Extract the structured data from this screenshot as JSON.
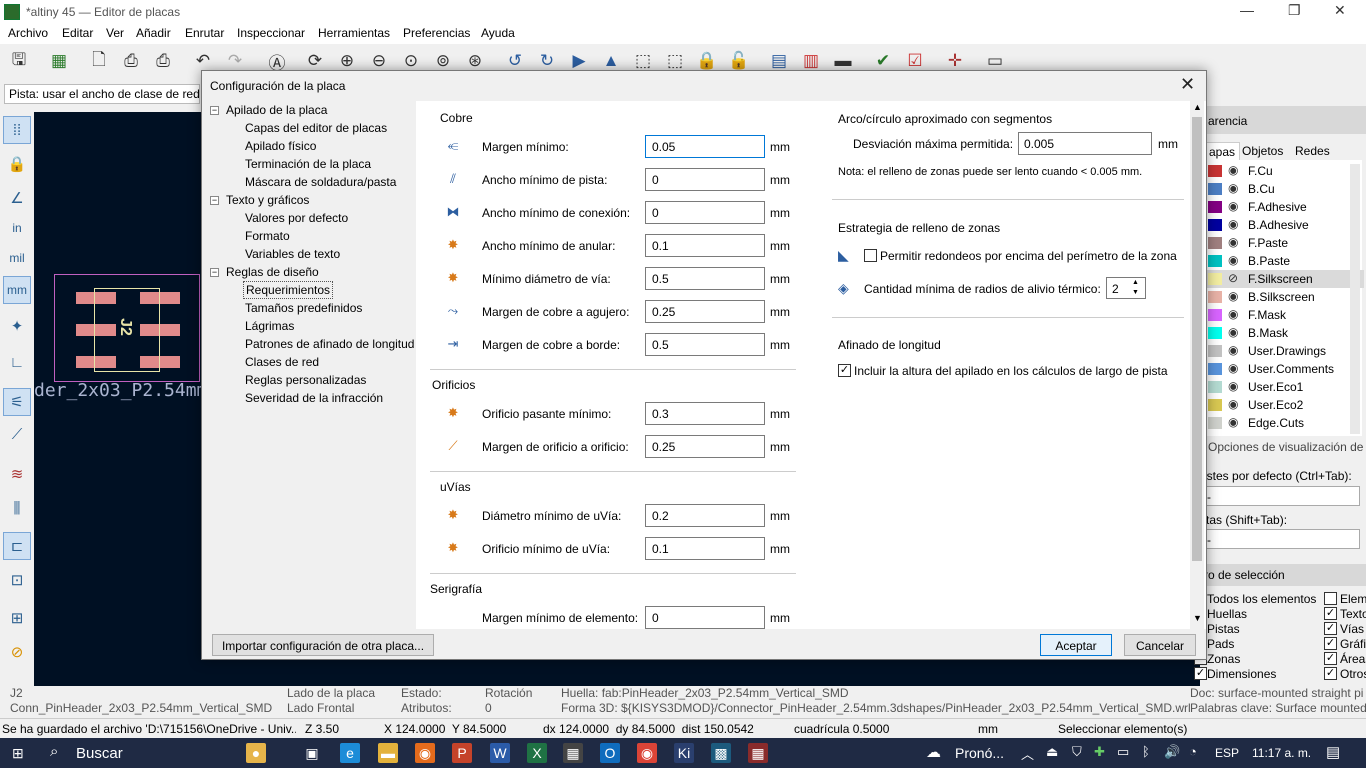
{
  "window": {
    "title": "*altiny 45 — Editor de placas"
  },
  "menu": [
    "Archivo",
    "Editar",
    "Ver",
    "Añadir",
    "Enrutar",
    "Inspeccionar",
    "Herramientas",
    "Preferencias",
    "Ayuda"
  ],
  "options_bar": {
    "track_width": "Pista: usar el ancho de clase de red"
  },
  "canvas": {
    "ref": "J2",
    "footprint_label": "der_2x03_P2.54mm"
  },
  "right_panel": {
    "title_partial": "arencia",
    "tabs": [
      "apas",
      "Objetos",
      "Redes"
    ],
    "layers": [
      {
        "name": "F.Cu",
        "color": "#c83434"
      },
      {
        "name": "B.Cu",
        "color": "#4d7fc4"
      },
      {
        "name": "F.Adhesive",
        "color": "#840084"
      },
      {
        "name": "B.Adhesive",
        "color": "#0000a0"
      },
      {
        "name": "F.Paste",
        "color": "#a08080"
      },
      {
        "name": "B.Paste",
        "color": "#00c2c2"
      },
      {
        "name": "F.Silkscreen",
        "color": "#f2eda1"
      },
      {
        "name": "B.Silkscreen",
        "color": "#e8b2a7"
      },
      {
        "name": "F.Mask",
        "color": "#d864ff"
      },
      {
        "name": "B.Mask",
        "color": "#02ffee"
      },
      {
        "name": "User.Drawings",
        "color": "#c2c2c2"
      },
      {
        "name": "User.Comments",
        "color": "#5994dc"
      },
      {
        "name": "User.Eco1",
        "color": "#b4dbd2"
      },
      {
        "name": "User.Eco2",
        "color": "#d8c852"
      },
      {
        "name": "Edge.Cuts",
        "color": "#d0d2cd"
      }
    ],
    "view_options": "Opciones de visualización de",
    "presets_label": "ustes por defecto (Ctrl+Tab):",
    "presets_value": "-",
    "views_label": "stas (Shift+Tab):",
    "views_value": "-",
    "filter_title": "ro de selección",
    "filter_left": [
      {
        "label": "Todos los elementos",
        "checked": false
      },
      {
        "label": "Huellas",
        "checked": true
      },
      {
        "label": "Pistas",
        "checked": true
      },
      {
        "label": "Pads",
        "checked": true
      },
      {
        "label": "Zonas",
        "checked": true
      },
      {
        "label": "Dimensiones",
        "checked": true
      }
    ],
    "filter_right": [
      {
        "label": "Eleme",
        "checked": false
      },
      {
        "label": "Texto",
        "checked": true
      },
      {
        "label": "Vías",
        "checked": true
      },
      {
        "label": "Gráfi",
        "checked": true
      },
      {
        "label": "Áreas",
        "checked": true
      },
      {
        "label": "Otros",
        "checked": true
      }
    ]
  },
  "dialog": {
    "title": "Configuración de la placa",
    "tree": [
      {
        "label": "Apilado de la placa",
        "level": 0
      },
      {
        "label": "Capas del editor de placas",
        "level": 1
      },
      {
        "label": "Apilado físico",
        "level": 1
      },
      {
        "label": "Terminación de la placa",
        "level": 1
      },
      {
        "label": "Máscara de soldadura/pasta",
        "level": 1
      },
      {
        "label": "Texto y gráficos",
        "level": 0
      },
      {
        "label": "Valores por defecto",
        "level": 1
      },
      {
        "label": "Formato",
        "level": 1
      },
      {
        "label": "Variables de texto",
        "level": 1
      },
      {
        "label": "Reglas de diseño",
        "level": 0
      },
      {
        "label": "Requerimientos",
        "level": 1,
        "selected": true
      },
      {
        "label": "Tamaños predefinidos",
        "level": 1
      },
      {
        "label": "Lágrimas",
        "level": 1
      },
      {
        "label": "Patrones de afinado de longitud",
        "level": 1
      },
      {
        "label": "Clases de red",
        "level": 1
      },
      {
        "label": "Reglas personalizadas",
        "level": 1
      },
      {
        "label": "Severidad de la infracción",
        "level": 1
      }
    ],
    "copper": {
      "title": "Cobre",
      "rows": [
        {
          "label": "Margen mínimo:",
          "value": "0.05",
          "unit": "mm",
          "icon": "clearance-icon"
        },
        {
          "label": "Ancho mínimo de pista:",
          "value": "0",
          "unit": "mm",
          "icon": "track-width-icon"
        },
        {
          "label": "Ancho mínimo de conexión:",
          "value": "0",
          "unit": "mm",
          "icon": "connection-width-icon"
        },
        {
          "label": "Ancho mínimo de anular:",
          "value": "0.1",
          "unit": "mm",
          "icon": "annular-width-icon"
        },
        {
          "label": "Mínimo diámetro de vía:",
          "value": "0.5",
          "unit": "mm",
          "icon": "via-diameter-icon"
        },
        {
          "label": "Margen de cobre a agujero:",
          "value": "0.25",
          "unit": "mm",
          "icon": "copper-hole-icon"
        },
        {
          "label": "Margen de cobre a borde:",
          "value": "0.5",
          "unit": "mm",
          "icon": "copper-edge-icon"
        }
      ]
    },
    "holes": {
      "title": "Orificios",
      "rows": [
        {
          "label": "Orificio pasante mínimo:",
          "value": "0.3",
          "unit": "mm",
          "icon": "through-hole-icon"
        },
        {
          "label": "Margen de orificio a orificio:",
          "value": "0.25",
          "unit": "mm",
          "icon": "hole-to-hole-icon"
        }
      ]
    },
    "uvias": {
      "title": "uVías",
      "rows": [
        {
          "label": "Diámetro mínimo de uVía:",
          "value": "0.2",
          "unit": "mm",
          "icon": "uvia-diameter-icon"
        },
        {
          "label": "Orificio mínimo de uVía:",
          "value": "0.1",
          "unit": "mm",
          "icon": "uvia-hole-icon"
        }
      ]
    },
    "silk": {
      "title": "Serigrafía",
      "rows": [
        {
          "label": "Margen mínimo de elemento:",
          "value": "0",
          "unit": "mm",
          "icon": "silk-clearance-icon"
        }
      ]
    },
    "arc": {
      "title": "Arco/círculo aproximado con segmentos",
      "label": "Desviación máxima permitida:",
      "value": "0.005",
      "unit": "mm",
      "note": "Nota: el relleno de zonas puede ser lento cuando < 0.005 mm."
    },
    "zone": {
      "title": "Estrategia de relleno de zonas",
      "fillet_label": "Permitir redondeos por encima del perímetro de la zona",
      "fillet_checked": false,
      "spokes_label": "Cantidad mínima de radios de alivio térmico:",
      "spokes_value": "2"
    },
    "length": {
      "title": "Afinado de longitud",
      "stackup_label": "Incluir la altura del apilado en los cálculos de largo de pista",
      "stackup_checked": true
    },
    "import_button": "Importar configuración de otra placa...",
    "ok_button": "Aceptar",
    "cancel_button": "Cancelar"
  },
  "status": {
    "ref": "J2",
    "value": "Conn_PinHeader_2x03_P2.54mm_Vertical_SMD",
    "side_label": "Lado de la placa",
    "side_value": "Lado Frontal",
    "state_label": "Estado:",
    "attr_label": "Atributos:",
    "rot_label": "Rotación",
    "rot_value": "0",
    "footprint": "Huella: fab:PinHeader_2x03_P2.54mm_Vertical_SMD",
    "model3d": "Forma 3D: ${KISYS3DMOD}/Connector_PinHeader_2.54mm.3dshapes/PinHeader_2x03_P2.54mm_Vertical_SMD.wrl",
    "doc": "Doc: surface-mounted straight pi",
    "keywords": "Palabras clave: Surface mounted"
  },
  "status2": {
    "saved": "Se ha guardado el archivo 'D:\\715156\\OneDrive - Univ...",
    "zoom": "Z 3.50",
    "xy": "X 124.0000  Y 84.5000",
    "dxy": "dx 124.0000  dy 84.5000  dist 150.0542",
    "grid": "cuadrícula 0.5000",
    "units": "mm",
    "mode": "Seleccionar elemento(s)"
  },
  "taskbar": {
    "search": "Buscar",
    "weather": "Pronó...",
    "lang": "ESP",
    "time": "11:17 a. m."
  }
}
